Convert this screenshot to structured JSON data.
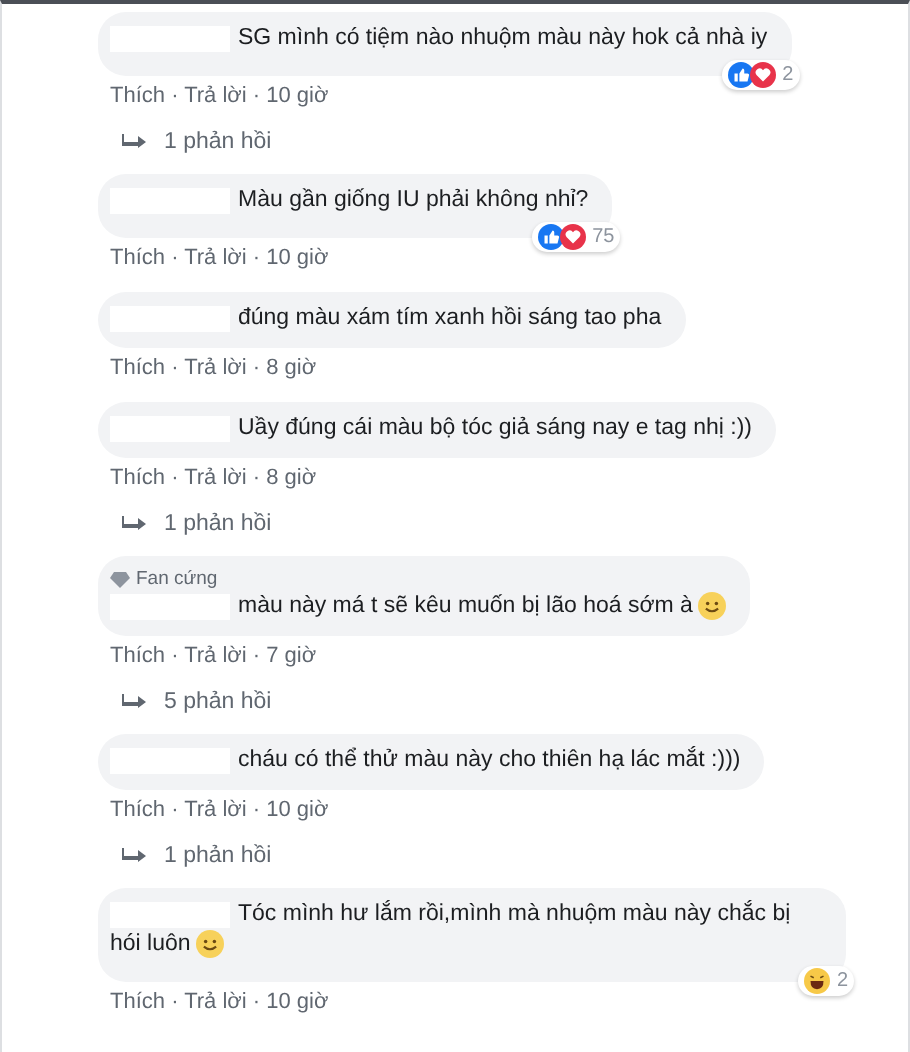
{
  "comments": [
    {
      "text": "SG mình có tiệm nào nhuộm màu này hok cả nhà iy",
      "smiley": false,
      "reactions": {
        "like": true,
        "love": true,
        "haha": false,
        "count": "2"
      },
      "meta": "Thích · Trả lời · 10 giờ",
      "replies": "1 phản hồi"
    },
    {
      "text": "Màu gần giống IU phải không nhỉ?",
      "smiley": false,
      "reactions": {
        "like": true,
        "love": true,
        "haha": false,
        "count": "75"
      },
      "meta": "Thích · Trả lời · 10 giờ"
    },
    {
      "text": "đúng màu xám tím xanh hồi sáng tao pha",
      "smiley": false,
      "meta": "Thích · Trả lời · 8 giờ"
    },
    {
      "text": "Uầy đúng cái màu bộ tóc giả sáng nay e tag nhị :))",
      "smiley": false,
      "meta": "Thích · Trả lời · 8 giờ",
      "replies": "1 phản hồi"
    },
    {
      "badge": "Fan cứng",
      "text": "màu này má t sẽ kêu muốn bị lão hoá sớm à",
      "smiley": true,
      "meta": "Thích · Trả lời · 7 giờ",
      "replies": "5 phản hồi"
    },
    {
      "text": "cháu có thể thử màu này cho thiên hạ lác mắt :)))",
      "smiley": false,
      "meta": "Thích · Trả lời · 10 giờ",
      "replies": "1 phản hồi"
    },
    {
      "text": "Tóc mình hư lắm rồi,mình mà nhuộm màu này chắc bị hói luôn",
      "smiley": true,
      "reactions": {
        "like": false,
        "love": false,
        "haha": true,
        "count": "2"
      },
      "meta": "Thích · Trả lời · 10 giờ"
    }
  ]
}
